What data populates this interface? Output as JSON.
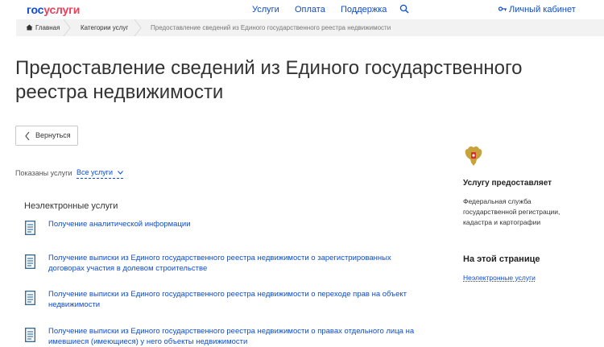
{
  "header": {
    "logo_part1": "гос",
    "logo_part2": "услуги",
    "nav": [
      "Услуги",
      "Оплата",
      "Поддержка"
    ],
    "cabinet_label": "Личный кабинет",
    "brand_blue": "#0d4cd3",
    "brand_red": "#ee3f58"
  },
  "breadcrumb": {
    "home": "Главная",
    "category": "Категории услуг",
    "current": "Предоставление сведений из Единого государственного реестра недвижимости"
  },
  "page": {
    "title": "Предоставление сведений из Единого государственного реестра недвижимости",
    "back_label": "Вернуться",
    "filter_label": "Показаны услуги",
    "filter_value": "Все услуги"
  },
  "section": {
    "title": "Неэлектронные услуги",
    "services": [
      "Получение аналитической информации",
      "Получение выписки из Единого государственного реестра недвижимости о зарегистрированных договорах участия в долевом строительстве",
      "Получение выписки из Единого государственного реестра недвижимости о переходе прав на объект недвижимости",
      "Получение выписки из Единого государственного реестра недвижимости о правах отдельного лица на имевшиеся (имеющиеся) у него объекты недвижимости"
    ]
  },
  "sidebar": {
    "provider_heading": "Услугу предоставляет",
    "provider_name": "Федеральная служба государственной регистрации, кадастра и картографии",
    "onpage_heading": "На этой странице",
    "onpage_link": "Неэлектронные услуги"
  }
}
